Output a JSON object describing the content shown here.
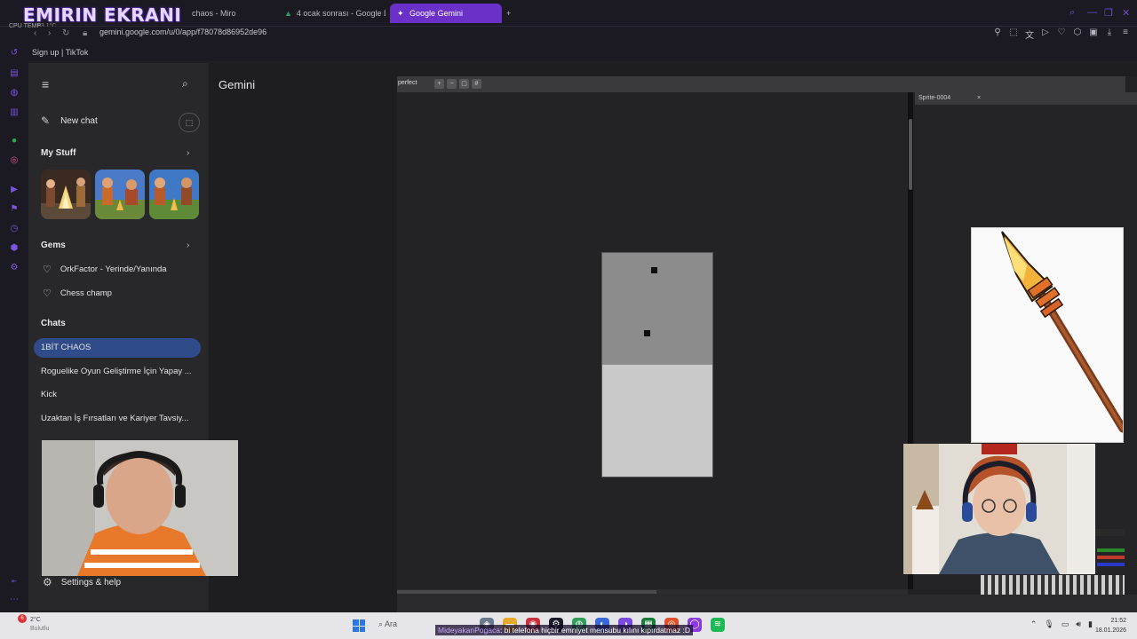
{
  "overlay_title": "EMIRIN EKRANI",
  "cpu_temp_label": "CPU TEMP",
  "cpu_temp_value": "53.1°C",
  "tabs": [
    {
      "label": "chaos - Miro",
      "icon": "miro-icon"
    },
    {
      "label": "4 ocak sonrası - Google D",
      "icon": "drive-icon"
    },
    {
      "label": "Google Gemini",
      "icon": "gemini-icon",
      "active": true
    }
  ],
  "new_tab_glyph": "+",
  "address_url": "gemini.google.com/u/0/app/f78078d86952de96",
  "bookmark": "Sign up | TikTok",
  "sidebar": {
    "new_chat": "New chat",
    "my_stuff": "My Stuff",
    "gems_heading": "Gems",
    "gems": [
      "OrkFactor - Yerinde/Yanında",
      "Chess champ"
    ],
    "chats_heading": "Chats",
    "chats": [
      "1BİT CHAOS",
      "Roguelike Oyun Geliştirme İçin Yapay ...",
      "Kick",
      "Uzaktan İş Fırsatları ve Kariyer Tavsiy..."
    ],
    "settings": "Settings & help"
  },
  "main_title": "Gemini",
  "editor": {
    "toolbar_label": "perfect",
    "panel_tab": "Sprite-0004",
    "panel_close": "×"
  },
  "taskbar": {
    "weather_temp": "2°C",
    "weather_desc": "Bulutlu",
    "weather_badge": "6",
    "search_placeholder": "Ara",
    "chat_user": "MideyakanPogaca",
    "chat_message": ": bi telefona hiçbir emniyet mensubu kılını kıpırdatmaz :D",
    "time": "21:52",
    "date": "18.01.2026"
  },
  "colors": {
    "accent": "#6a30c8",
    "active_chat": "#2f4b8a",
    "sidebar_bg": "#28282b"
  }
}
